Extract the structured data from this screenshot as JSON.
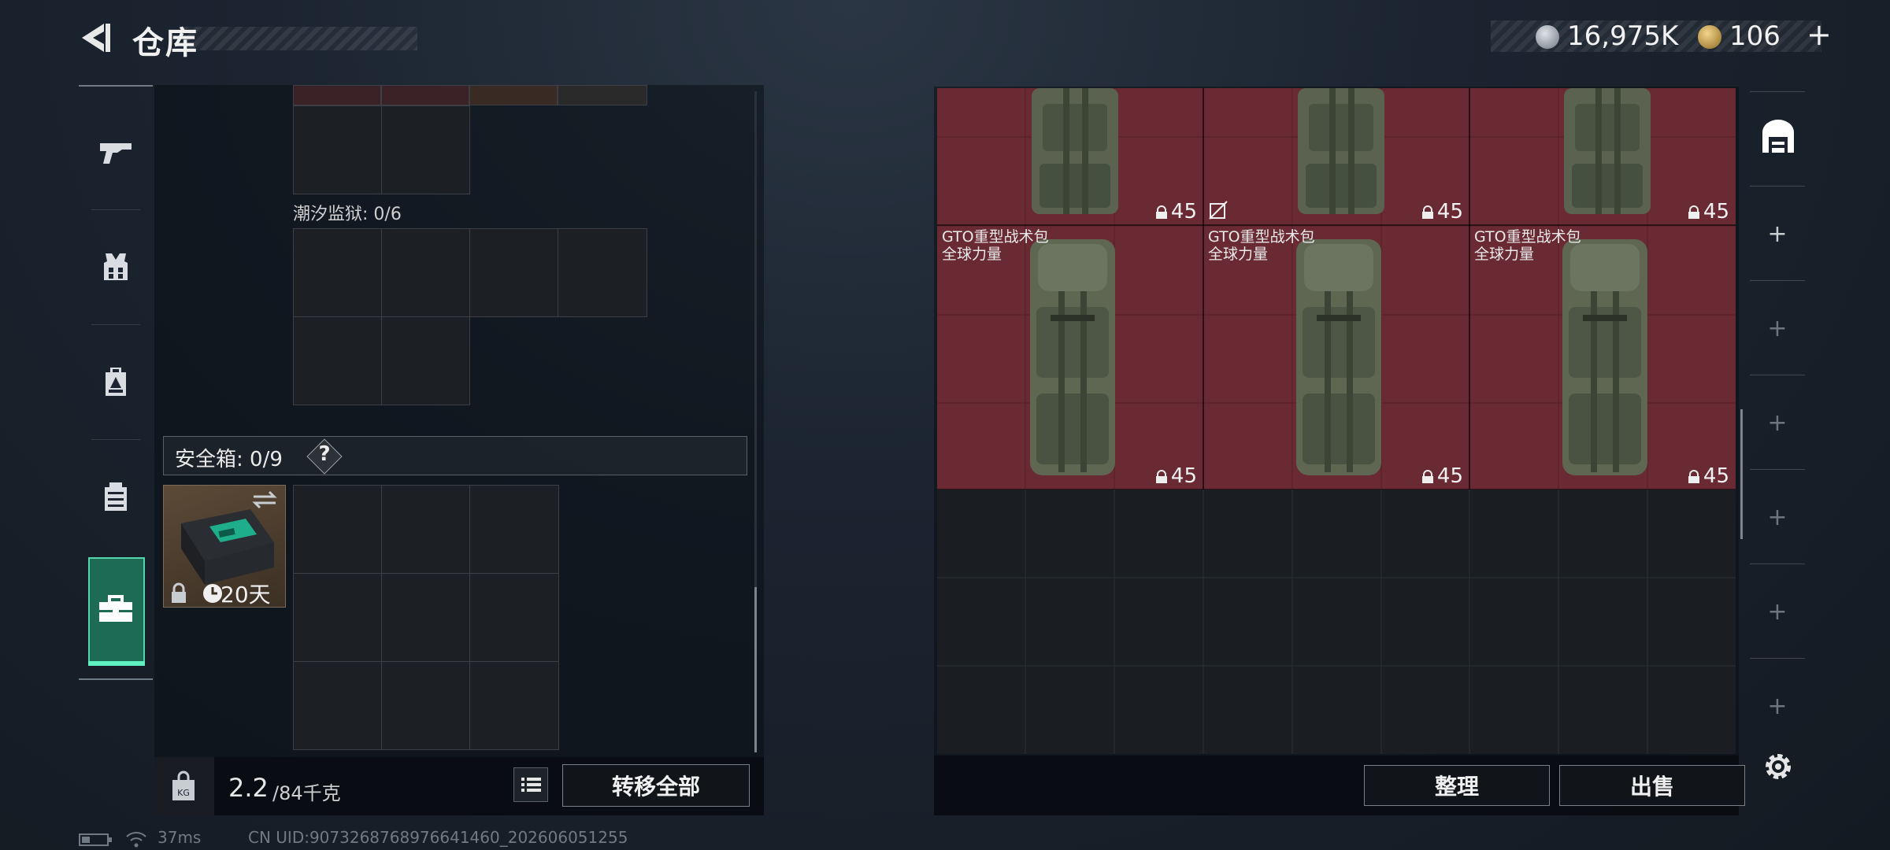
{
  "header": {
    "title": "仓库"
  },
  "currency": {
    "coins": "16,975K",
    "tokens": "106",
    "plus": "+"
  },
  "left_panel": {
    "prison_label": "潮汐监狱: 0/6",
    "safe_box_label": "安全箱: 0/9",
    "safe_help": "?",
    "safe_item_days": "20天",
    "weight_value": "2.2",
    "weight_max": "/84千克",
    "transfer_all": "转移全部"
  },
  "right_panel": {
    "items": [
      {
        "name1": "",
        "name2": "",
        "count": "45"
      },
      {
        "name1": "",
        "name2": "",
        "count": "45"
      },
      {
        "name1": "",
        "name2": "",
        "count": "45"
      },
      {
        "name1": "GTO重型战术包",
        "name2": "全球力量",
        "count": "45"
      },
      {
        "name1": "GTO重型战术包",
        "name2": "全球力量",
        "count": "45"
      },
      {
        "name1": "GTO重型战术包",
        "name2": "全球力量",
        "count": "45"
      }
    ],
    "organize": "整理",
    "sell": "出售"
  },
  "status_bar": {
    "ping": "37ms",
    "uid": "CN UID:9073268768976641460_202606051255"
  },
  "colors": {
    "accent": "#53d6ab",
    "item_bg": "#6a2a33"
  }
}
